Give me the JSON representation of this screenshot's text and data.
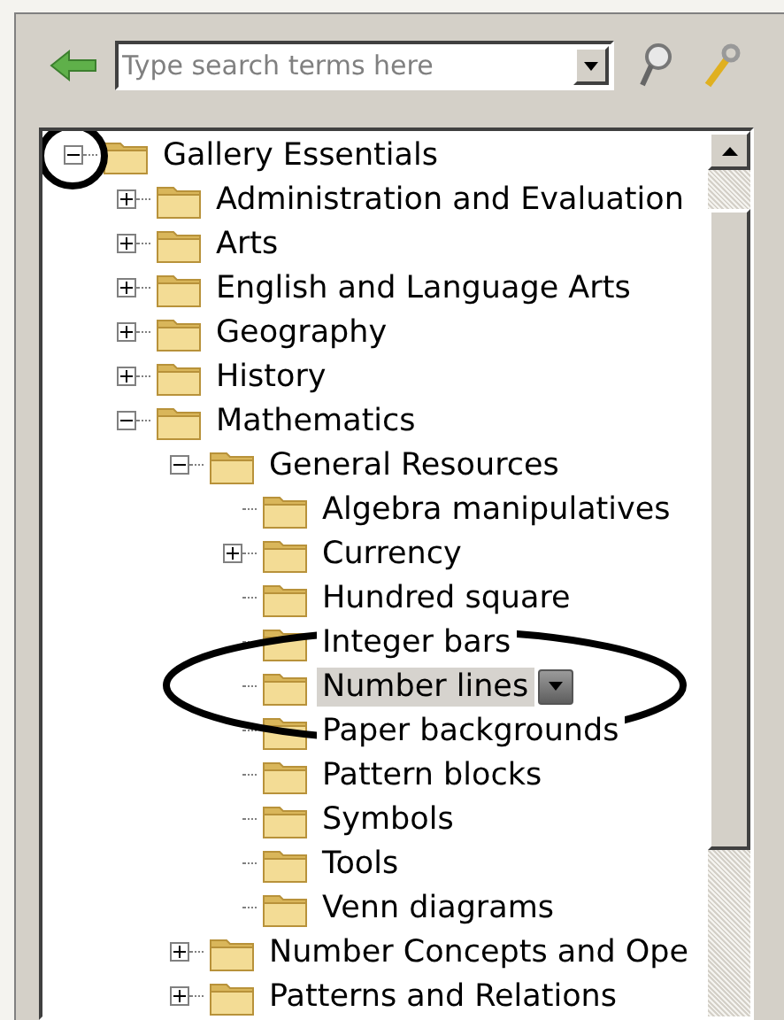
{
  "search": {
    "placeholder": "Type search terms here"
  },
  "tree": [
    {
      "label": "Gallery Essentials",
      "kind": "branch",
      "expanded": true,
      "selected": false,
      "circled": true,
      "children": [
        {
          "label": "Administration and Evaluation",
          "kind": "branch",
          "expanded": false,
          "selected": false,
          "circled": false
        },
        {
          "label": "Arts",
          "kind": "branch",
          "expanded": false,
          "selected": false,
          "circled": false
        },
        {
          "label": "English and Language Arts",
          "kind": "branch",
          "expanded": false,
          "selected": false,
          "circled": false
        },
        {
          "label": "Geography",
          "kind": "branch",
          "expanded": false,
          "selected": false,
          "circled": false
        },
        {
          "label": "History",
          "kind": "branch",
          "expanded": false,
          "selected": false,
          "circled": false
        },
        {
          "label": "Mathematics",
          "kind": "branch",
          "expanded": true,
          "selected": false,
          "circled": false,
          "children": [
            {
              "label": "General Resources",
              "kind": "branch",
              "expanded": true,
              "selected": false,
              "circled": false,
              "children": [
                {
                  "label": "Algebra manipulatives",
                  "kind": "leaf",
                  "selected": false,
                  "circled": false
                },
                {
                  "label": "Currency",
                  "kind": "branch",
                  "expanded": false,
                  "selected": false,
                  "circled": false
                },
                {
                  "label": "Hundred square",
                  "kind": "leaf",
                  "selected": false,
                  "circled": false
                },
                {
                  "label": "Integer bars",
                  "kind": "leaf",
                  "selected": false,
                  "circled": false
                },
                {
                  "label": "Number lines",
                  "kind": "leaf",
                  "selected": true,
                  "circled": true
                },
                {
                  "label": "Paper backgrounds",
                  "kind": "leaf",
                  "selected": false,
                  "circled": false
                },
                {
                  "label": "Pattern blocks",
                  "kind": "leaf",
                  "selected": false,
                  "circled": false
                },
                {
                  "label": "Symbols",
                  "kind": "leaf",
                  "selected": false,
                  "circled": false
                },
                {
                  "label": "Tools",
                  "kind": "leaf",
                  "selected": false,
                  "circled": false
                },
                {
                  "label": "Venn diagrams",
                  "kind": "leaf",
                  "selected": false,
                  "circled": false
                }
              ]
            },
            {
              "label": "Number Concepts and Ope",
              "kind": "branch",
              "expanded": false,
              "selected": false,
              "circled": false
            },
            {
              "label": "Patterns and Relations",
              "kind": "branch",
              "expanded": false,
              "selected": false,
              "circled": false
            }
          ]
        }
      ]
    }
  ]
}
